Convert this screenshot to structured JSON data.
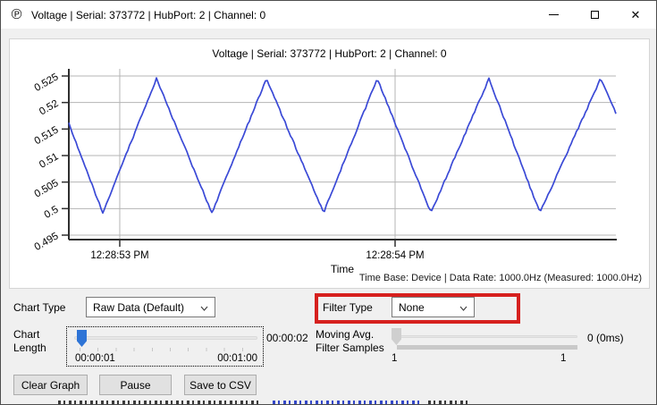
{
  "window": {
    "title": "Voltage | Serial: 373772 | HubPort: 2 | Channel: 0",
    "icon": "℗",
    "close_glyph": "✕"
  },
  "chart_panel": {
    "footer": "Time Base: Device  |  Data Rate: 1000.0Hz (Measured: 1000.0Hz)"
  },
  "chart_data": {
    "type": "line",
    "title": "Voltage | Serial: 373772 | HubPort: 2 | Channel: 0",
    "xlabel": "Time",
    "ylabel": "",
    "x_tick_labels": [
      "12:28:53 PM",
      "12:28:54 PM"
    ],
    "x_tick_frac": [
      0.0931,
      0.5964
    ],
    "y_ticks": [
      0.525,
      0.52,
      0.515,
      0.51,
      0.505,
      0.5,
      0.495
    ],
    "ylim": [
      0.495,
      0.525
    ],
    "grid": true,
    "grid_color": "#b5b5b5",
    "axis_color": "#2f2f2f",
    "series": [
      {
        "name": "Voltage",
        "color": "#3a49d6",
        "waveform": "triangle-with-noise",
        "trough": 0.4992,
        "peak": 0.5245,
        "breakpoints_x_frac": [
          0.0,
          0.0621,
          0.1601,
          0.2614,
          0.3611,
          0.4657,
          0.5637,
          0.6618,
          0.768,
          0.8611,
          0.9722,
          1.0
        ],
        "breakpoints_value": [
          0.516,
          0.4992,
          0.5245,
          0.4992,
          0.5245,
          0.4992,
          0.5245,
          0.4992,
          0.5245,
          0.4992,
          0.5245,
          0.518
        ]
      }
    ]
  },
  "controls": {
    "chart_type": {
      "label": "Chart Type",
      "value": "Raw Data (Default)"
    },
    "filter_type": {
      "label": "Filter Type",
      "value": "None"
    },
    "chart_length": {
      "label_line1": "Chart",
      "label_line2": "Length",
      "value": "00:00:02",
      "min_label": "00:00:01",
      "max_label": "00:01:00"
    },
    "moving_avg": {
      "label_line1": "Moving Avg.",
      "label_line2": "Filter Samples",
      "value": "0 (0ms)",
      "min_label": "1",
      "max_label": "1"
    },
    "buttons": [
      {
        "label": "Clear Graph"
      },
      {
        "label": "Pause"
      },
      {
        "label": "Save to CSV"
      }
    ]
  },
  "annotation": {
    "color": "#d6201e"
  }
}
